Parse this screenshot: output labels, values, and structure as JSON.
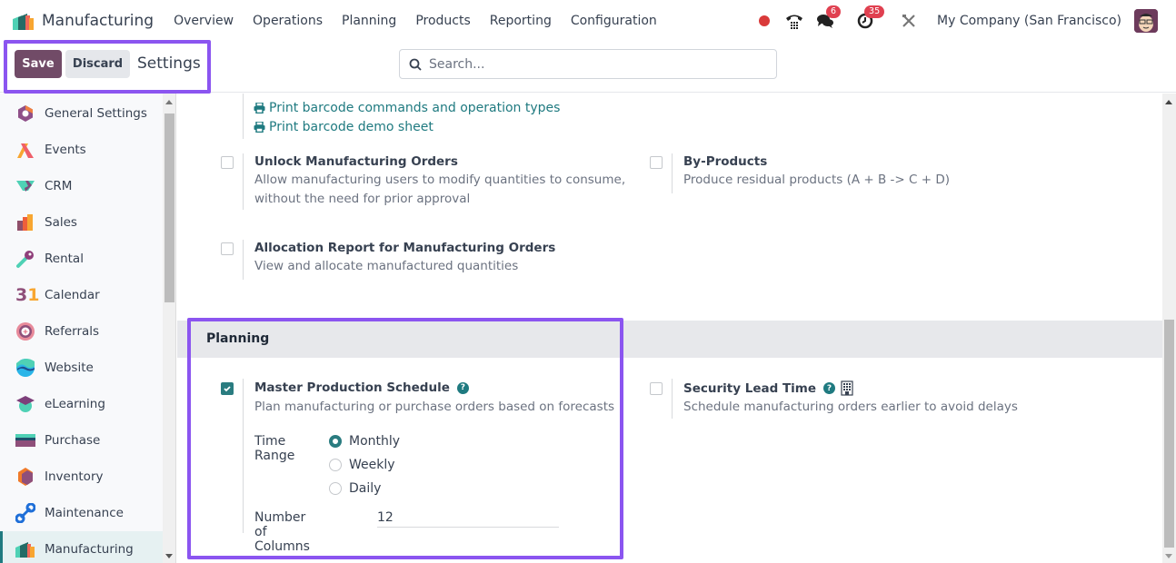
{
  "navbar": {
    "app_name": "Manufacturing",
    "menu": [
      "Overview",
      "Operations",
      "Planning",
      "Products",
      "Reporting",
      "Configuration"
    ],
    "icons": [
      "recording-dot-icon",
      "phone-icon",
      "chat-icon",
      "activity-clock-icon",
      "tools-icon"
    ],
    "chat_badge": "6",
    "activity_badge": "35",
    "company": "My Company (San Francisco)"
  },
  "control_panel": {
    "save_label": "Save",
    "discard_label": "Discard",
    "title": "Settings",
    "search_placeholder": "Search...",
    "search_value": ""
  },
  "sidebar": {
    "items": [
      {
        "label": "General Settings",
        "icon": "general-settings-icon"
      },
      {
        "label": "Events",
        "icon": "events-icon"
      },
      {
        "label": "CRM",
        "icon": "crm-icon"
      },
      {
        "label": "Sales",
        "icon": "sales-icon"
      },
      {
        "label": "Rental",
        "icon": "rental-icon"
      },
      {
        "label": "Calendar",
        "icon": "calendar-icon"
      },
      {
        "label": "Referrals",
        "icon": "referrals-icon"
      },
      {
        "label": "Website",
        "icon": "website-icon"
      },
      {
        "label": "eLearning",
        "icon": "elearning-icon"
      },
      {
        "label": "Purchase",
        "icon": "purchase-icon"
      },
      {
        "label": "Inventory",
        "icon": "inventory-icon"
      },
      {
        "label": "Maintenance",
        "icon": "maintenance-icon"
      },
      {
        "label": "Manufacturing",
        "icon": "manufacturing-icon",
        "active": true
      }
    ]
  },
  "main": {
    "links": [
      "Print barcode commands and operation types",
      "Print barcode demo sheet"
    ],
    "settings": {
      "unlock_mo": {
        "title": "Unlock Manufacturing Orders",
        "desc_line1": "Allow manufacturing users to modify quantities to consume,",
        "desc_line2": "without the need for prior approval",
        "checked": false
      },
      "by_products": {
        "title": "By-Products",
        "desc": "Produce residual products (A + B -> C + D)",
        "checked": false
      },
      "allocation_report": {
        "title": "Allocation Report for Manufacturing Orders",
        "desc": "View and allocate manufactured quantities",
        "checked": false
      }
    },
    "planning_section": {
      "title": "Planning",
      "mps": {
        "title": "Master Production Schedule",
        "desc": "Plan manufacturing or purchase orders based on forecasts",
        "checked": true,
        "time_range_label": "Time Range",
        "time_range_options": [
          "Monthly",
          "Weekly",
          "Daily"
        ],
        "time_range_selected": "Monthly",
        "columns_label": "Number of Columns",
        "columns_value": "12"
      },
      "security_lead_time": {
        "title": "Security Lead Time",
        "desc": "Schedule manufacturing orders earlier to avoid delays",
        "checked": false
      }
    }
  },
  "colors": {
    "brand": "#714b67",
    "accent": "#1f7a80",
    "highlight": "#8b55f0",
    "badge": "#e04050"
  }
}
